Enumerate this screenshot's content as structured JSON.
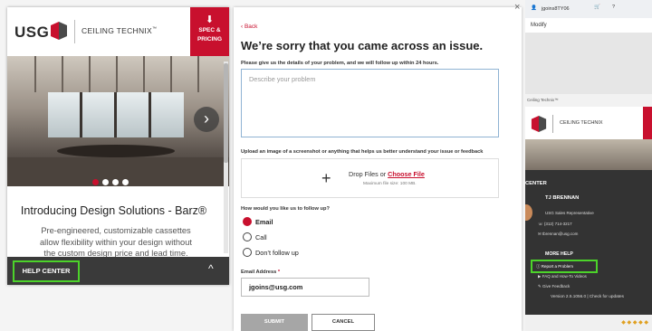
{
  "left_panel": {
    "logo_text": "USG",
    "brand": "CEILING TECHNIX",
    "brand_tm": "™",
    "spec_icon": "download-icon",
    "spec_label_1": "SPEC &",
    "spec_label_2": "PRICING",
    "next_icon": "chevron-right-icon",
    "next_glyph": "›",
    "title": "Introducing Design Solutions - Barz®",
    "description": "Pre-engineered, customizable cassettes allow flexibility within your design without the custom design price and lead time.",
    "carousel_dots": 4,
    "carousel_active": 1,
    "help_center_label": "HELP CENTER",
    "collapse_glyph": "^"
  },
  "form": {
    "back": "‹  Back",
    "close_glyph": "×",
    "heading": "We’re sorry that you came across an issue.",
    "instructions": "Please give us the details of your problem, and we will follow up within 24 hours.",
    "problem_placeholder": "Describe your problem",
    "upload_label": "Upload an image of a screenshot or anything that helps us better understand your issue or feedback",
    "drop_text": "Drop Files or",
    "choose_file": "Choose File",
    "max_size": "Maximum file size: 100 MB.",
    "followup_label": "How would you like us to follow up?",
    "options": [
      {
        "label": "Email",
        "selected": true
      },
      {
        "label": "Call",
        "selected": false
      },
      {
        "label": "Don’t follow up",
        "selected": false
      }
    ],
    "email_label": "Email Address",
    "email_required_mark": "*",
    "email_value": "jgoins@usg.com",
    "submit_label": "SUBMIT",
    "cancel_label": "CANCEL"
  },
  "right_panel": {
    "user": "jgoins8TY06",
    "menu_item": "Modify",
    "tab_label": "Ceiling Technix™",
    "brand": "CEILING TECHNIX",
    "section_title": "CENTER",
    "contact_name": "TJ BRENNAN",
    "contact_role": "USG Sales Representative",
    "phone": "(312) 714-3217",
    "email": "tbrennan@usg.com",
    "more_help": "MORE HELP",
    "report_problem": "Report a Problem",
    "faq": "FAQ and How-To Videos",
    "feedback": "Give Feedback",
    "version": "Version 2.5.1056.0 | Check for updates"
  },
  "colors": {
    "accent_red": "#c8102e",
    "highlight_green": "#4cd32a",
    "dark_footer": "#3a3a3a"
  }
}
